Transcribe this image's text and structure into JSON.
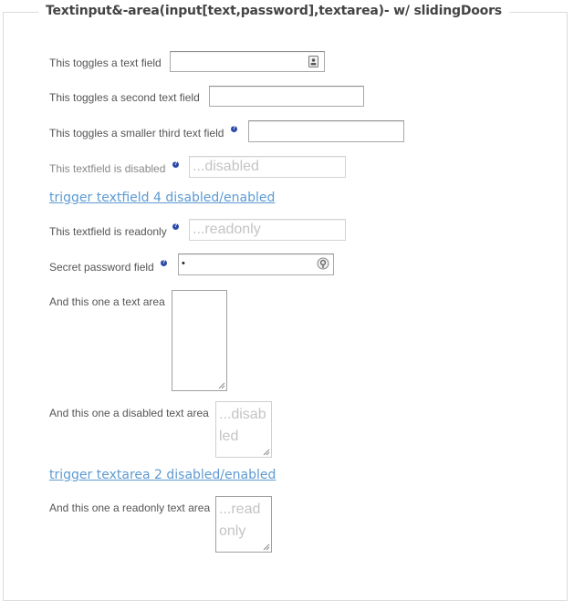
{
  "legend": "Textinput&-area(input[text,password],textarea)- w/ slidingDoors",
  "fields": {
    "text1_label": "This toggles a text field",
    "text2_label": "This toggles a second text field",
    "text3_label": "This toggles a smaller third text field",
    "text4_label": "This textfield is disabled",
    "text4_value": "...disabled",
    "trigger_text4": "trigger textfield 4 disabled/enabled",
    "text5_label": "This textfield is readonly",
    "text5_value": "...readonly",
    "password_label": "Secret password field",
    "password_value": "•",
    "textarea1_label": "And this one a text area",
    "textarea2_label": "And this one a disabled text area",
    "textarea2_value": "...disabled",
    "trigger_textarea2": "trigger textarea 2 disabled/enabled",
    "textarea3_label": "And this one a readonly text area",
    "textarea3_value": "...readonly"
  },
  "help_glyph": "?",
  "colors": {
    "link": "#5d9ad2",
    "help_icon": "#2b4aa8",
    "border": "#dcdcdc"
  },
  "icons": {
    "text1": "contact-card-icon",
    "password": "keychain-icon",
    "help": "help-icon"
  }
}
